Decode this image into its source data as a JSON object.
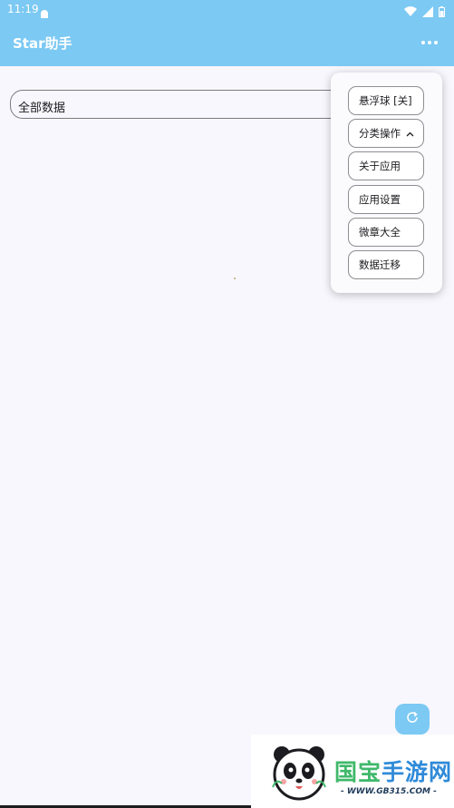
{
  "status_bar": {
    "time": "11:19",
    "icons": [
      "android-icon",
      "wifi-icon",
      "signal-icon",
      "battery-icon"
    ]
  },
  "app_bar": {
    "title": "Star助手",
    "more_icon": "more-horizontal-icon"
  },
  "filter": {
    "selected": "全部数据"
  },
  "menu": {
    "items": [
      {
        "label": "悬浮球 [关]"
      },
      {
        "label": "分类操作",
        "icon": "chevron-up-icon"
      },
      {
        "label": "关于应用"
      },
      {
        "label": "应用设置"
      },
      {
        "label": "微章大全"
      },
      {
        "label": "数据迁移"
      }
    ]
  },
  "fab": {
    "icon": "refresh-icon"
  },
  "watermark": {
    "brand_green": "国宝",
    "brand_blue": "手游网",
    "url": "- WWW.GB315.COM -"
  },
  "colors": {
    "accent": "#7cc9f3",
    "background": "#f8f7fd"
  }
}
